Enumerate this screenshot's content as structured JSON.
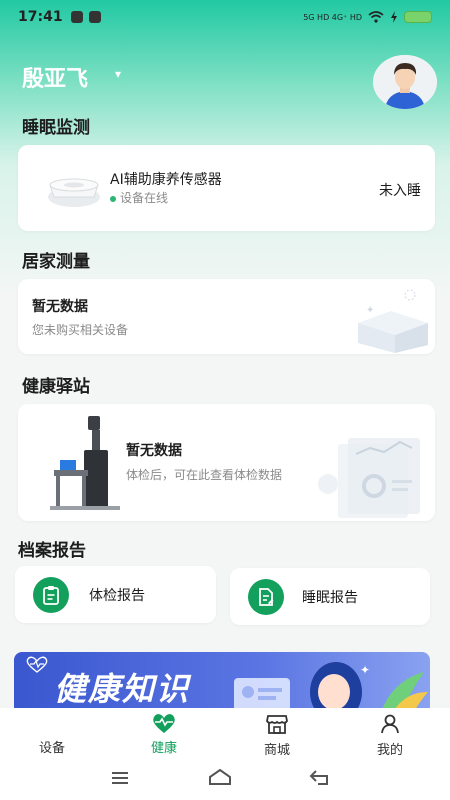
{
  "status_bar": {
    "time": "17:41",
    "network_label": "5G HD 4G⁺ HD"
  },
  "header": {
    "user_name": "殷亚飞",
    "caret": "▾"
  },
  "sleep_monitor": {
    "title": "睡眠监测",
    "device_name": "AI辅助康养传感器",
    "device_status": "设备在线",
    "sleep_state": "未入睡"
  },
  "home_measure": {
    "title": "居家测量",
    "empty_title": "暂无数据",
    "empty_sub": "您未购买相关设备"
  },
  "health_station": {
    "title": "健康驿站",
    "empty_title": "暂无数据",
    "empty_sub": "体检后，可在此查看体检数据"
  },
  "archive": {
    "title": "档案报告",
    "reports": [
      {
        "label": "体检报告"
      },
      {
        "label": "睡眠报告"
      }
    ]
  },
  "banner": {
    "title": "健康知识"
  },
  "tabbar": {
    "tabs": [
      {
        "label": "设备",
        "active": false
      },
      {
        "label": "健康",
        "active": true
      },
      {
        "label": "商城",
        "active": false
      },
      {
        "label": "我的",
        "active": false
      }
    ]
  },
  "colors": {
    "accent": "#12a05c",
    "gradient_top": "#21c9a3",
    "banner": "#3a57cf",
    "online": "#2bb673"
  }
}
